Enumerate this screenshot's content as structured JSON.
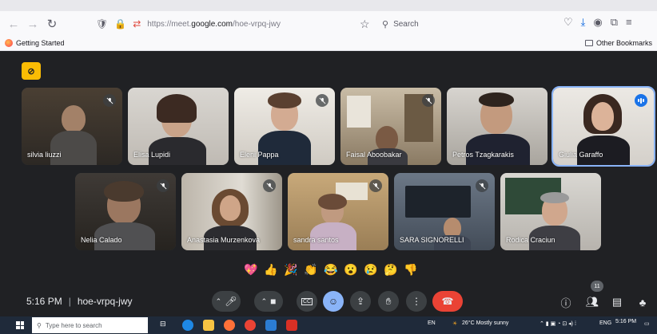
{
  "browser": {
    "url_prefix": "https://meet.",
    "url_domain": "google.com",
    "url_path": "/hoe-vrpq-jwy",
    "search_placeholder": "Search",
    "bookmark_left": "Getting Started",
    "bookmark_right": "Other Bookmarks"
  },
  "participants_row1": [
    {
      "name": "silvia liuzzi",
      "muted": true,
      "active": false
    },
    {
      "name": "Elisa Lupidi",
      "muted": false,
      "active": false
    },
    {
      "name": "Eleni Pappa",
      "muted": true,
      "active": false
    },
    {
      "name": "Faisal Aboobakar",
      "muted": true,
      "active": false
    },
    {
      "name": "Petros Tzagkarakis",
      "muted": false,
      "active": false
    },
    {
      "name": "Giulia Garaffo",
      "muted": false,
      "active": true
    }
  ],
  "participants_row2": [
    {
      "name": "Nelia Calado",
      "muted": true
    },
    {
      "name": "Anastasia Murzenkova",
      "muted": true
    },
    {
      "name": "sandra santos",
      "muted": true
    },
    {
      "name": "SARA SIGNORELLI",
      "muted": true
    },
    {
      "name": "Rodica Craciun",
      "muted": false
    }
  ],
  "reactions": [
    "💖",
    "👍",
    "🎉",
    "👏",
    "😂",
    "😮",
    "😢",
    "🤔",
    "👎"
  ],
  "meeting": {
    "time": "5:16 PM",
    "code": "hoe-vrpq-jwy",
    "participant_count": "11"
  },
  "taskbar": {
    "search_placeholder": "Type here to search",
    "lang": "EN",
    "weather": "26°C  Mostly sunny",
    "keyboard": "ENG",
    "clock_time": "5:16 PM"
  }
}
